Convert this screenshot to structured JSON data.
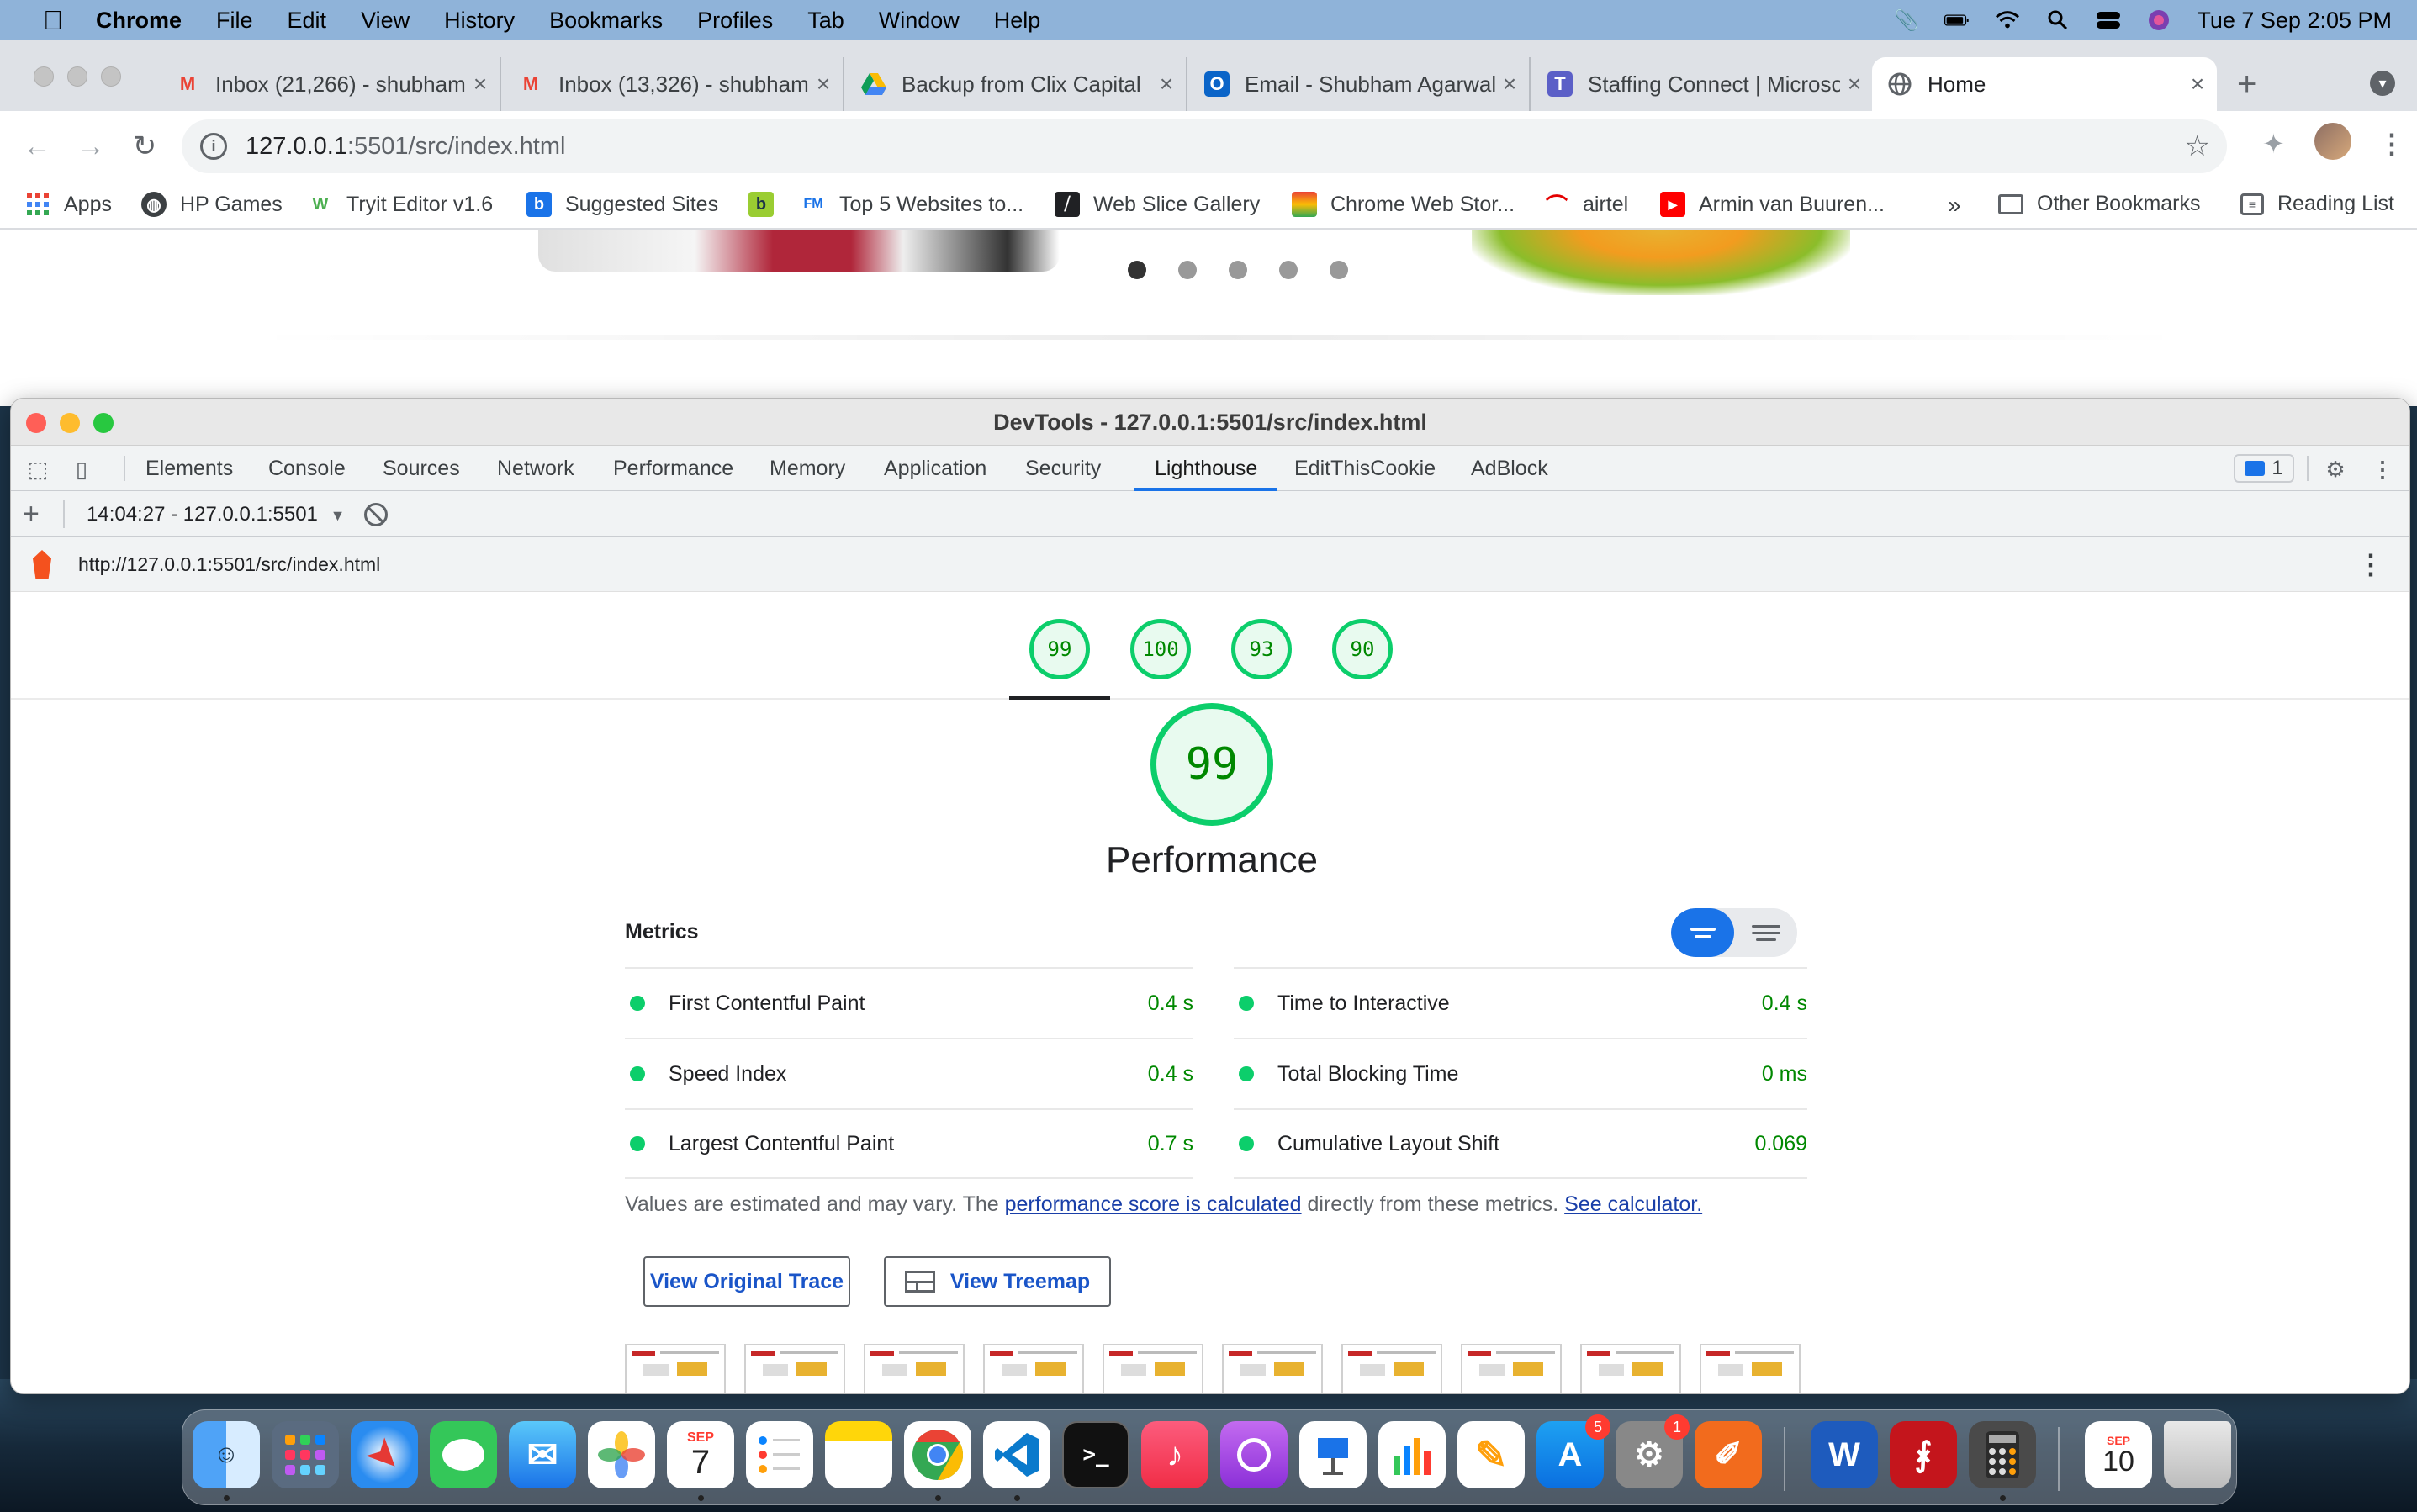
{
  "menubar": {
    "app": "Chrome",
    "items": [
      "File",
      "Edit",
      "View",
      "History",
      "Bookmarks",
      "Profiles",
      "Tab",
      "Window",
      "Help"
    ],
    "datetime": "Tue 7 Sep  2:05 PM"
  },
  "tabs": [
    {
      "label": "Inbox (21,266) - shubham",
      "icon": "gmail-icon"
    },
    {
      "label": "Inbox (13,326) - shubham",
      "icon": "gmail-icon"
    },
    {
      "label": "Backup from Clix Capital",
      "icon": "google-drive-icon"
    },
    {
      "label": "Email - Shubham Agarwal",
      "icon": "outlook-icon"
    },
    {
      "label": "Staffing Connect | Microsoft",
      "icon": "teams-icon"
    },
    {
      "label": "Home",
      "icon": "globe-icon",
      "active": true
    }
  ],
  "address": {
    "host": "127.0.0.1",
    "rest": ":5501/src/index.html"
  },
  "bookmarks": [
    {
      "label": "Apps"
    },
    {
      "label": "HP Games"
    },
    {
      "label": "Tryit Editor v1.6"
    },
    {
      "label": "Suggested Sites"
    },
    {
      "label": ""
    },
    {
      "label": "Top 5 Websites to..."
    },
    {
      "label": "Web Slice Gallery"
    },
    {
      "label": "Chrome Web Stor..."
    },
    {
      "label": "airtel"
    },
    {
      "label": "Armin van Buuren..."
    }
  ],
  "bookmarks_overflow": "»",
  "other_bookmarks": "Other Bookmarks",
  "reading_list": "Reading List",
  "devtools": {
    "title": "DevTools - 127.0.0.1:5501/src/index.html",
    "tabs": [
      "Elements",
      "Console",
      "Sources",
      "Network",
      "Performance",
      "Memory",
      "Application",
      "Security",
      "Lighthouse",
      "EditThisCookie",
      "AdBlock"
    ],
    "active_tab": "Lighthouse",
    "message_count": "1",
    "report_selector": "14:04:27 - 127.0.0.1:5501",
    "report_url": "http://127.0.0.1:5501/src/index.html"
  },
  "scores": [
    "99",
    "100",
    "93",
    "90"
  ],
  "performance": {
    "score": "99",
    "title": "Performance",
    "metrics_heading": "Metrics",
    "metrics_left": [
      {
        "name": "First Contentful Paint",
        "value": "0.4 s"
      },
      {
        "name": "Speed Index",
        "value": "0.4 s"
      },
      {
        "name": "Largest Contentful Paint",
        "value": "0.7 s"
      }
    ],
    "metrics_right": [
      {
        "name": "Time to Interactive",
        "value": "0.4 s"
      },
      {
        "name": "Total Blocking Time",
        "value": "0 ms"
      },
      {
        "name": "Cumulative Layout Shift",
        "value": "0.069"
      }
    ],
    "note_prefix": "Values are estimated and may vary. The ",
    "note_link1": "performance score is calculated",
    "note_middle": " directly from these metrics. ",
    "note_link2": "See calculator.",
    "btn_trace": "View Original Trace",
    "btn_treemap": "View Treemap"
  },
  "dock": {
    "calendar_month": "SEP",
    "calendar_day": "7",
    "calendar2_month": "SEP",
    "calendar2_day": "10",
    "appstore_badge": "5",
    "prefs_badge": "1"
  },
  "colors": {
    "pass": "#0cce6b",
    "accent": "#1a73e8"
  }
}
